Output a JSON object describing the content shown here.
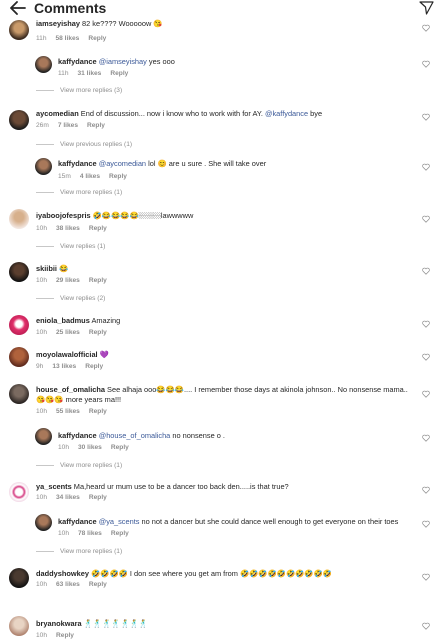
{
  "header": {
    "title": "Comments"
  },
  "comments": [
    {
      "username": "iamseyishay",
      "text": " 82 ke???? Wooooow 😘",
      "time": "11h",
      "likes": "58 likes",
      "reply": "Reply"
    },
    {
      "username": "kaffydance",
      "mention": "@iamseyishay",
      "text": " yes ooo",
      "time": "11h",
      "likes": "31 likes",
      "reply": "Reply",
      "view_more": "View more replies (3)"
    },
    {
      "username": "aycomedian",
      "text": " End of discussion... now i know who to work with for AY. ",
      "mention": "@kaffydance",
      "text2": " bye",
      "time": "26m",
      "likes": "7 likes",
      "reply": "Reply",
      "view_prev": "View previous replies (1)"
    },
    {
      "username": "kaffydance",
      "mention": "@aycomedian",
      "text": " lol 😊 are u sure . She will take over",
      "time": "15m",
      "likes": "4 likes",
      "reply": "Reply",
      "view_more": "View more replies (1)"
    },
    {
      "username": "iyaboojofespris",
      "text": " 🤣😂😂😂😂🏼🏼🏼lawwwww",
      "time": "10h",
      "likes": "38 likes",
      "reply": "Reply",
      "view_replies": "View replies (1)"
    },
    {
      "username": "skiibii",
      "text": " 😂",
      "time": "10h",
      "likes": "29 likes",
      "reply": "Reply",
      "view_replies": "View replies (2)"
    },
    {
      "username": "eniola_badmus",
      "text": " Amazing",
      "time": "10h",
      "likes": "25 likes",
      "reply": "Reply"
    },
    {
      "username": "moyolawalofficial",
      "text": " 💜",
      "time": "9h",
      "likes": "13 likes",
      "reply": "Reply"
    },
    {
      "username": "house_of_omalicha",
      "text": " See alhaja ooo😂😂😂.... I remember those days at akinola johnson.. No nonsense mama.. ",
      "text2": "😘😘😘 more years ma!!!",
      "time": "10h",
      "likes": "55 likes",
      "reply": "Reply"
    },
    {
      "username": "kaffydance",
      "mention": "@house_of_omalicha",
      "text": " no nonsense o .",
      "time": "10h",
      "likes": "30 likes",
      "reply": "Reply",
      "view_more": "View more replies (1)"
    },
    {
      "username": "ya_scents",
      "text": " Ma,heard ur mum use to be a dancer too back den.....is that true?",
      "time": "10h",
      "likes": "34 likes",
      "reply": "Reply"
    },
    {
      "username": "kaffydance",
      "mention": "@ya_scents",
      "text": " no not a dancer but she could dance well enough to get everyone on their toes",
      "time": "10h",
      "likes": "78 likes",
      "reply": "Reply",
      "view_more": "View more replies (1)"
    },
    {
      "username": "daddyshowkey",
      "text": " 🤣🤣🤣🤣 I don see where you get am from 🤣🤣🤣🤣🤣🤣🤣🤣🤣🤣",
      "time": "10h",
      "likes": "63 likes",
      "reply": "Reply"
    },
    {
      "username": "bryanokwara",
      "text": " 🕺🕺🕺🕺🕺🕺🕺",
      "time": "10h",
      "likes": "",
      "reply": "Reply"
    }
  ]
}
